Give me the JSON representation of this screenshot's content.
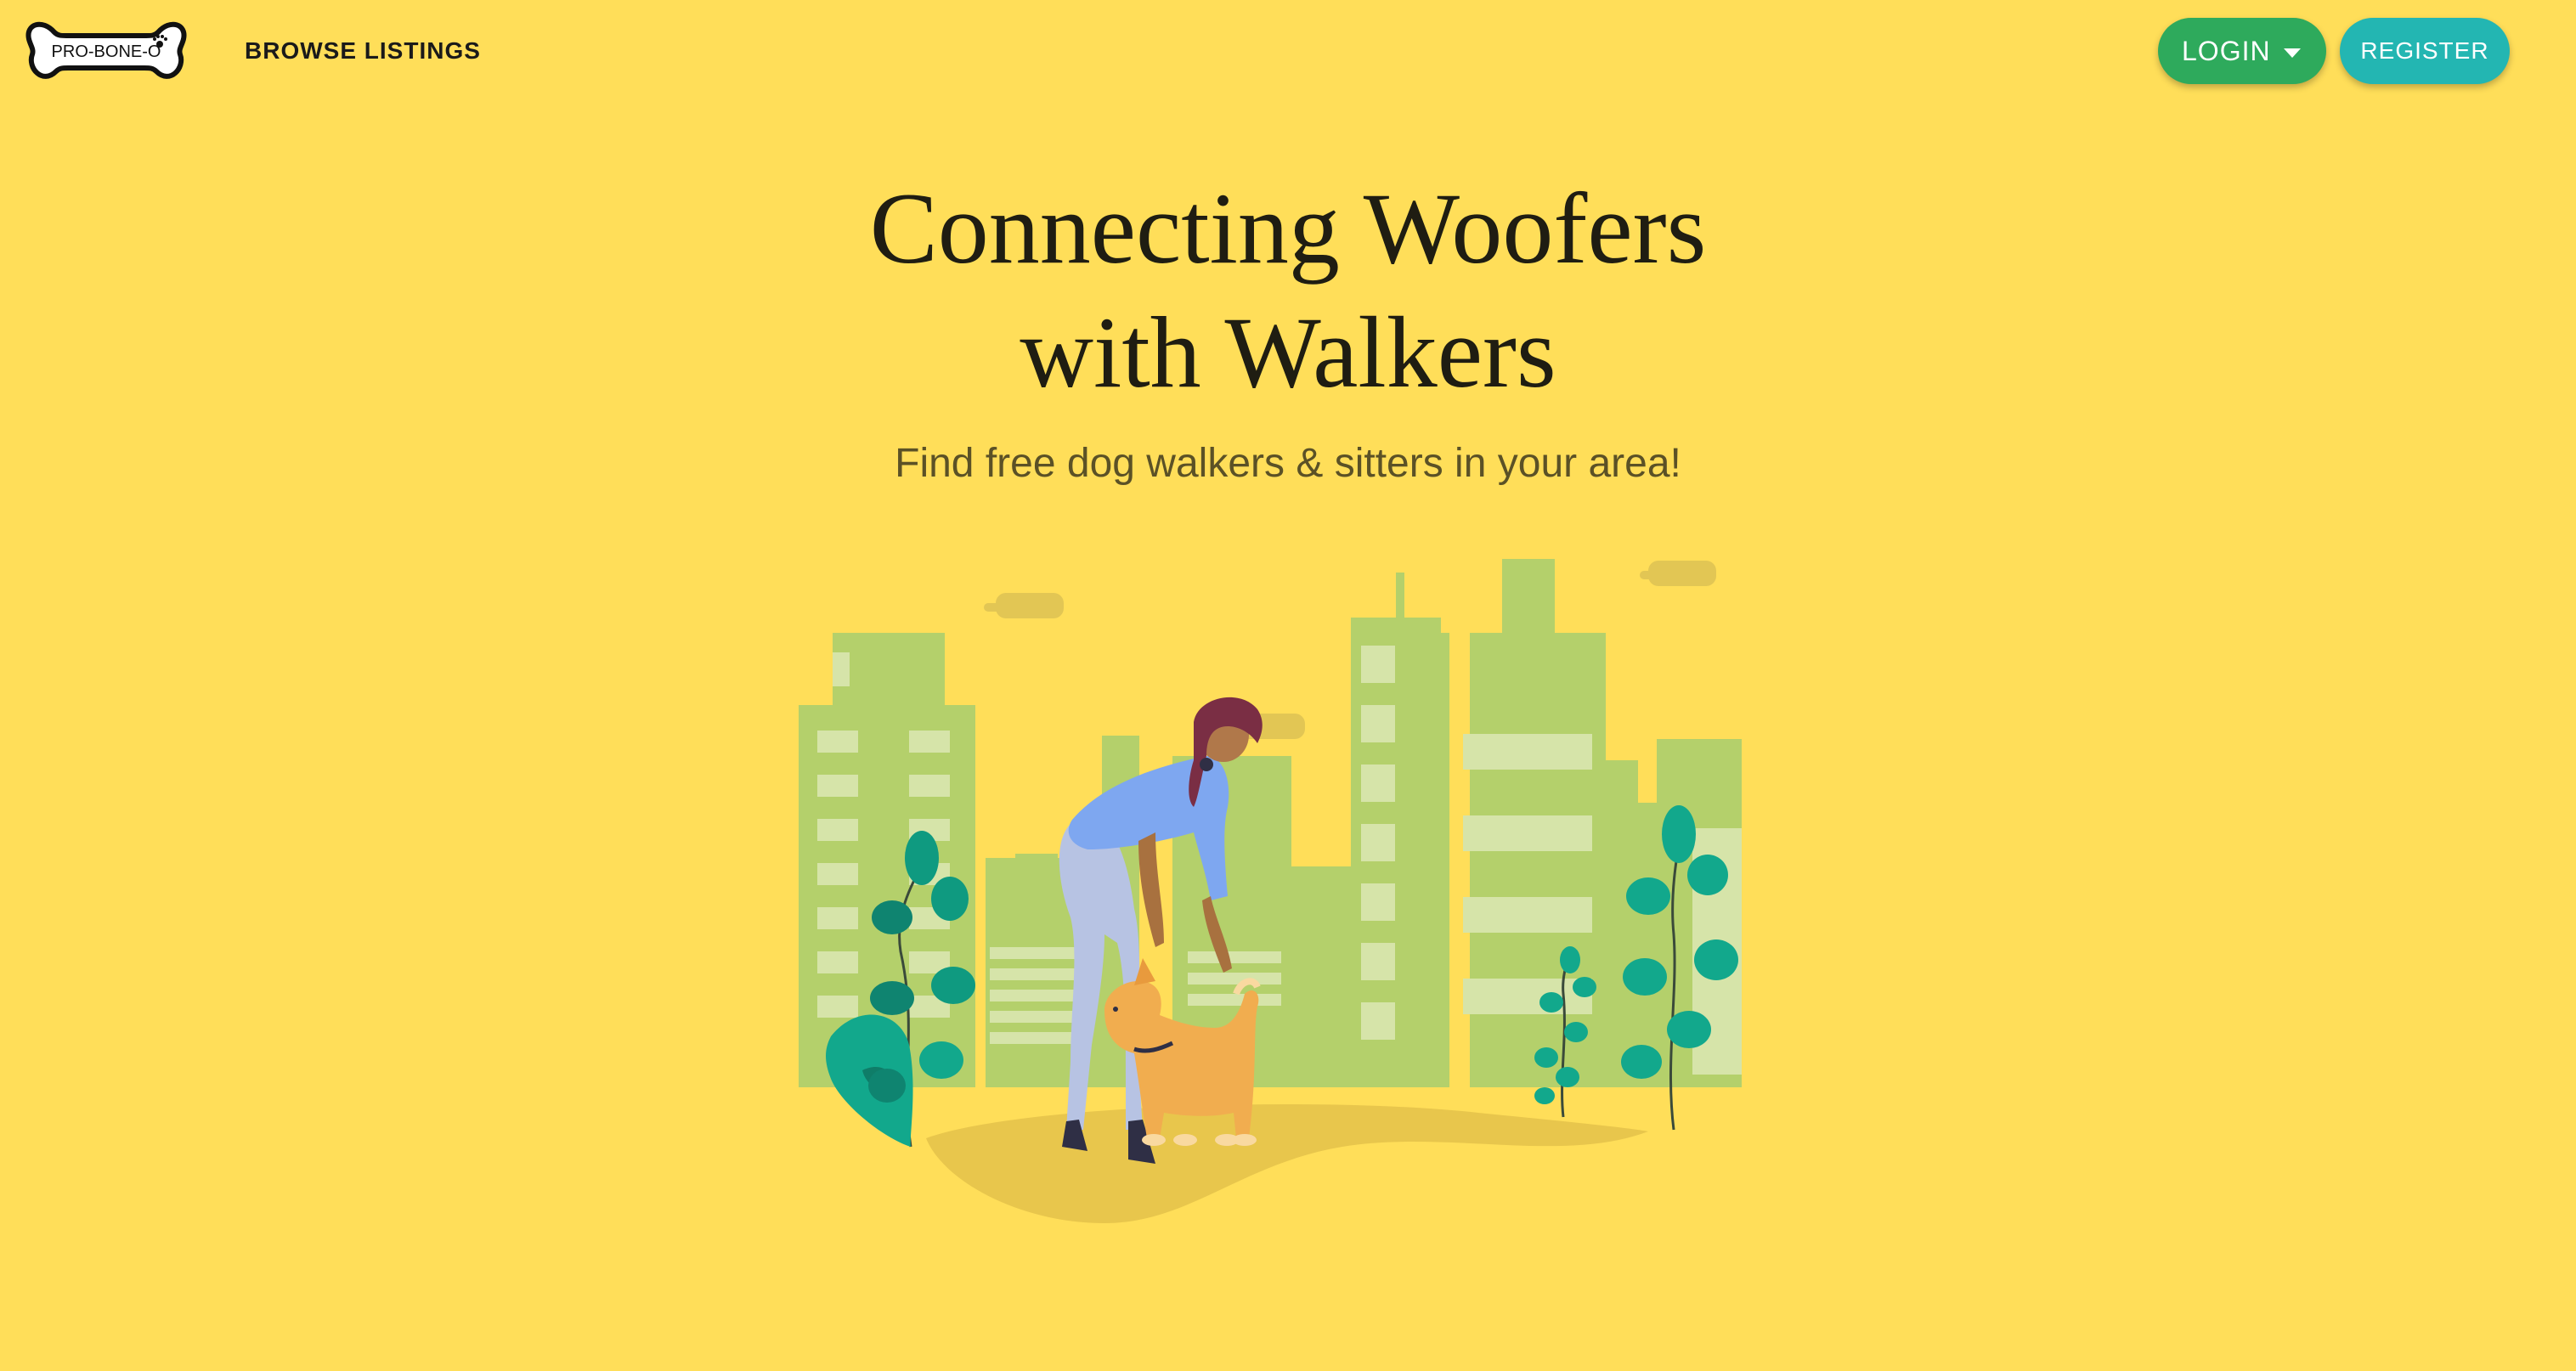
{
  "brand": {
    "logo_text": "PRO-BONE-O"
  },
  "nav": {
    "browse_label": "BROWSE LISTINGS",
    "login_label": "LOGIN",
    "register_label": "REGISTER"
  },
  "hero": {
    "title_line1": "Connecting Woofers",
    "title_line2": "with Walkers",
    "subtitle": "Find free dog walkers & sitters in your area!"
  },
  "colors": {
    "background": "#ffde59",
    "login": "#2eaa5c",
    "register": "#23b6b2",
    "buildings": "#b4d06b",
    "plants": "#12a88c"
  }
}
